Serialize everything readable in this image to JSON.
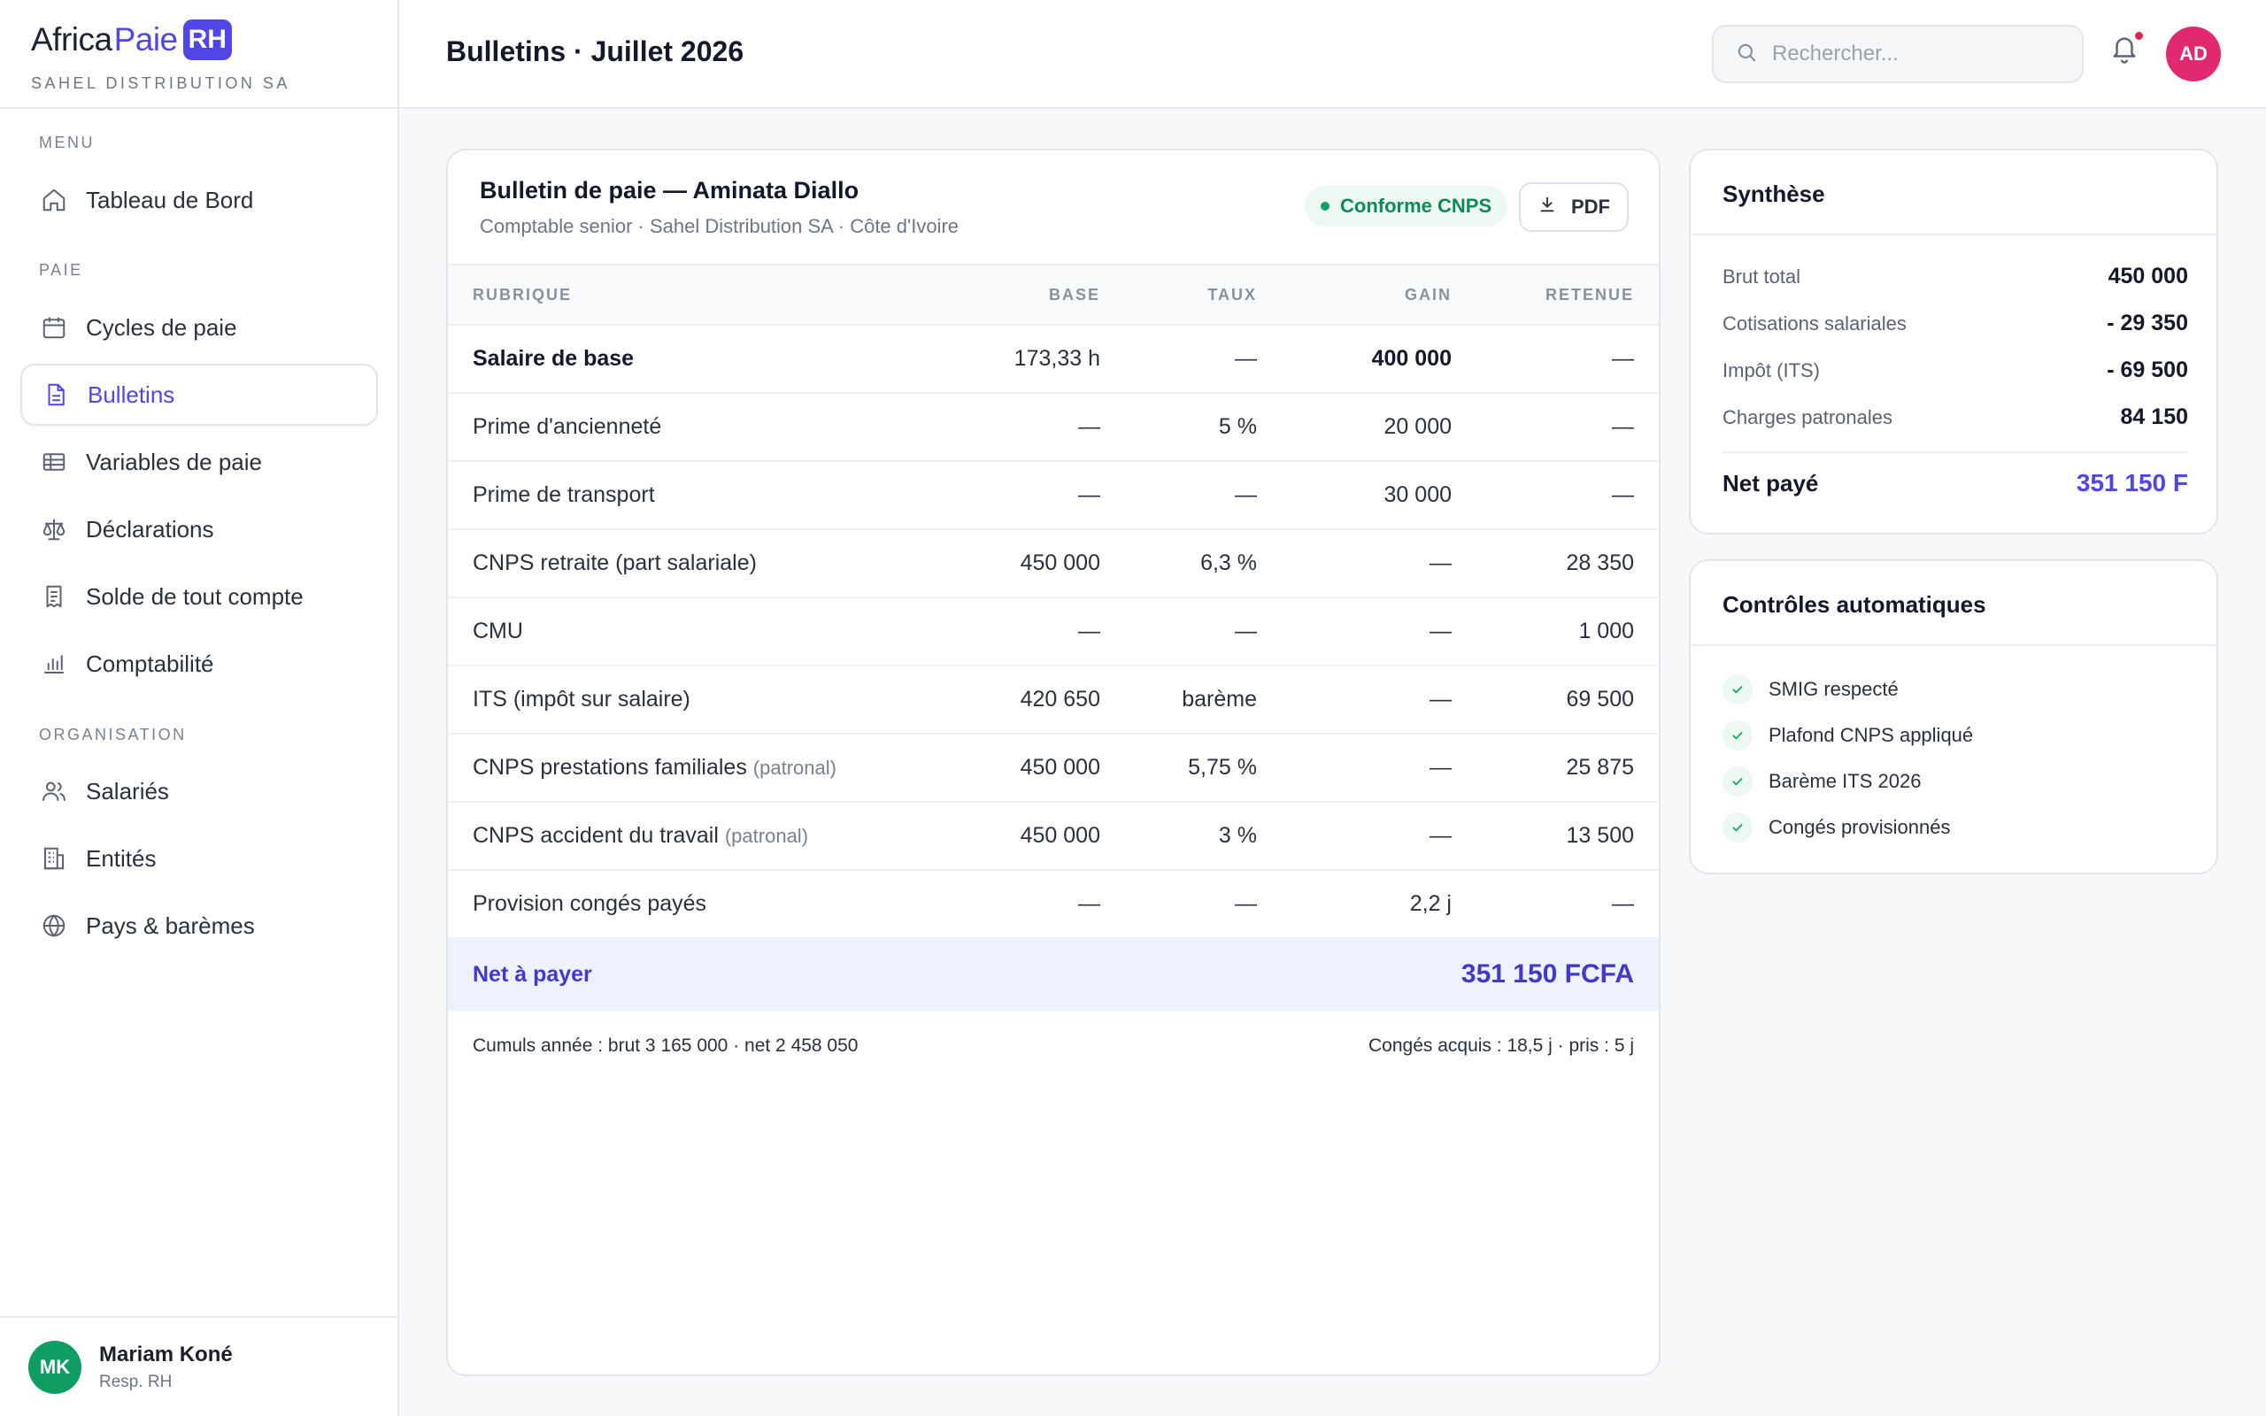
{
  "brand": {
    "part1": "Africa",
    "part2": "Paie",
    "badge": "RH",
    "company": "SAHEL DISTRIBUTION SA"
  },
  "sidebar": {
    "sections": {
      "menu": "MENU",
      "paie": "PAIE",
      "organisation": "ORGANISATION"
    },
    "items": [
      {
        "label": "Tableau de Bord",
        "icon": "home-icon"
      },
      {
        "label": "Cycles de paie",
        "icon": "calendar-icon"
      },
      {
        "label": "Bulletins",
        "icon": "document-icon"
      },
      {
        "label": "Variables de paie",
        "icon": "table-icon"
      },
      {
        "label": "Déclarations",
        "icon": "scale-icon"
      },
      {
        "label": "Solde de tout compte",
        "icon": "receipt-icon"
      },
      {
        "label": "Comptabilité",
        "icon": "bar-chart-icon"
      },
      {
        "label": "Salariés",
        "icon": "users-icon"
      },
      {
        "label": "Entités",
        "icon": "building-icon"
      },
      {
        "label": "Pays & barèmes",
        "icon": "globe-icon"
      }
    ],
    "active": "Bulletins"
  },
  "user": {
    "initials": "MK",
    "name": "Mariam Koné",
    "role": "Resp. RH"
  },
  "topbar": {
    "title": "Bulletins · Juillet 2026",
    "search_placeholder": "Rechercher...",
    "avatar": "AD"
  },
  "payslip": {
    "title": "Bulletin de paie — Aminata Diallo",
    "subtitle": "Comptable senior · Sahel Distribution SA · Côte d'Ivoire",
    "badge": "Conforme CNPS",
    "pdf_label": "PDF",
    "columns": {
      "rubrique": "RUBRIQUE",
      "base": "BASE",
      "taux": "TAUX",
      "gain": "GAIN",
      "retenue": "RETENUE"
    },
    "rows": [
      {
        "rubrique": "Salaire de base",
        "note": "",
        "base": "173,33 h",
        "taux": "—",
        "gain": "400 000",
        "retenue": "—"
      },
      {
        "rubrique": "Prime d'ancienneté",
        "note": "",
        "base": "—",
        "taux": "5 %",
        "gain": "20 000",
        "retenue": "—"
      },
      {
        "rubrique": "Prime de transport",
        "note": "",
        "base": "—",
        "taux": "—",
        "gain": "30 000",
        "retenue": "—"
      },
      {
        "rubrique": "CNPS retraite (part salariale)",
        "note": "",
        "base": "450 000",
        "taux": "6,3 %",
        "gain": "—",
        "retenue": "28 350"
      },
      {
        "rubrique": "CMU",
        "note": "",
        "base": "—",
        "taux": "—",
        "gain": "—",
        "retenue": "1 000"
      },
      {
        "rubrique": "ITS (impôt sur salaire)",
        "note": "",
        "base": "420 650",
        "taux": "barème",
        "gain": "—",
        "retenue": "69 500"
      },
      {
        "rubrique": "CNPS prestations familiales",
        "note": "(patronal)",
        "base": "450 000",
        "taux": "5,75 %",
        "gain": "—",
        "retenue": "25 875"
      },
      {
        "rubrique": "CNPS accident du travail",
        "note": "(patronal)",
        "base": "450 000",
        "taux": "3 %",
        "gain": "—",
        "retenue": "13 500"
      },
      {
        "rubrique": "Provision congés payés",
        "note": "",
        "base": "—",
        "taux": "—",
        "gain": "2,2 j",
        "retenue": "—"
      }
    ],
    "net_label": "Net à payer",
    "net_value": "351 150 FCFA",
    "cumuls_left": "Cumuls année : brut 3 165 000 · net 2 458 050",
    "cumuls_right": "Congés acquis : 18,5 j · pris : 5 j"
  },
  "synthese": {
    "title": "Synthèse",
    "rows": [
      {
        "label": "Brut total",
        "value": "450 000"
      },
      {
        "label": "Cotisations salariales",
        "value": "- 29 350"
      },
      {
        "label": "Impôt (ITS)",
        "value": "- 69 500"
      },
      {
        "label": "Charges patronales",
        "value": "84 150"
      }
    ],
    "net_label": "Net payé",
    "net_value": "351 150 F"
  },
  "controles": {
    "title": "Contrôles automatiques",
    "items": [
      "SMIG respecté",
      "Plafond CNPS appliqué",
      "Barème ITS 2026",
      "Congés provisionnés"
    ]
  },
  "colors": {
    "accent": "#4f46e5",
    "success": "#12a26a",
    "alert": "#e5234f",
    "avatar_top": "#e0296f",
    "avatar_user": "#0f9d63"
  }
}
